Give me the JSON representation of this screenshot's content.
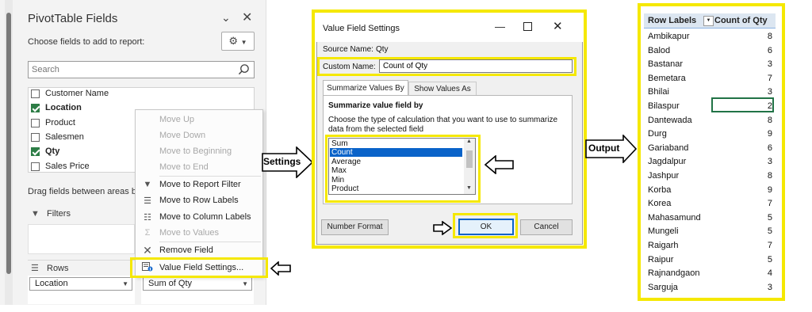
{
  "pivot_pane": {
    "title": "PivotTable Fields",
    "choose_label": "Choose fields to add to report:",
    "search_placeholder": "Search",
    "fields": [
      {
        "label": "Customer Name",
        "checked": false
      },
      {
        "label": "Location",
        "checked": true
      },
      {
        "label": "Product",
        "checked": false
      },
      {
        "label": "Salesmen",
        "checked": false
      },
      {
        "label": "Qty",
        "checked": true
      },
      {
        "label": "Sales Price",
        "checked": false
      }
    ],
    "drag_label": "Drag fields between areas be",
    "filters_label": "Filters",
    "rows_label": "Rows",
    "rows_chip": "Location",
    "values_chip": "Sum of Qty"
  },
  "context_menu": {
    "items": [
      {
        "label": "Move Up",
        "enabled": false,
        "icon": ""
      },
      {
        "label": "Move Down",
        "enabled": false,
        "icon": ""
      },
      {
        "label": "Move to Beginning",
        "enabled": false,
        "icon": ""
      },
      {
        "label": "Move to End",
        "enabled": false,
        "icon": ""
      },
      {
        "label": "Move to Report Filter",
        "enabled": true,
        "icon": "filter-icon"
      },
      {
        "label": "Move to Row Labels",
        "enabled": true,
        "icon": "rows-icon"
      },
      {
        "label": "Move to Column Labels",
        "enabled": true,
        "icon": "columns-icon"
      },
      {
        "label": "Move to Values",
        "enabled": false,
        "icon": "sigma-icon"
      },
      {
        "label": "Remove Field",
        "enabled": true,
        "icon": "x-icon"
      },
      {
        "label": "Value Field Settings...",
        "enabled": true,
        "icon": "field-settings-icon"
      }
    ]
  },
  "callouts": {
    "settings": "Settings",
    "output": "Output"
  },
  "dialog": {
    "title": "Value Field Settings",
    "source_name_label": "Source Name:",
    "source_name_value": "Qty",
    "custom_name_label": "Custom Name:",
    "custom_name_value": "Count of Qty",
    "tab_summarize": "Summarize Values By",
    "tab_show": "Show Values As",
    "summarize_header": "Summarize value field by",
    "summarize_desc": "Choose the type of calculation that you want to use to summarize data from the selected field",
    "functions": [
      "Sum",
      "Count",
      "Average",
      "Max",
      "Min",
      "Product"
    ],
    "selected_function": "Count",
    "number_format_label": "Number Format",
    "ok_label": "OK",
    "cancel_label": "Cancel"
  },
  "output": {
    "header_row_labels": "Row Labels",
    "header_count": "Count of Qty",
    "rows": [
      {
        "name": "Ambikapur",
        "count": "8"
      },
      {
        "name": "Balod",
        "count": "6"
      },
      {
        "name": "Bastanar",
        "count": "3"
      },
      {
        "name": "Bemetara",
        "count": "7"
      },
      {
        "name": "Bhilai",
        "count": "3"
      },
      {
        "name": "Bilaspur",
        "count": "2"
      },
      {
        "name": "Dantewada",
        "count": "8"
      },
      {
        "name": "Durg",
        "count": "9"
      },
      {
        "name": "Gariaband",
        "count": "6"
      },
      {
        "name": "Jagdalpur",
        "count": "3"
      },
      {
        "name": "Jashpur",
        "count": "8"
      },
      {
        "name": "Korba",
        "count": "9"
      },
      {
        "name": "Korea",
        "count": "7"
      },
      {
        "name": "Mahasamund",
        "count": "5"
      },
      {
        "name": "Mungeli",
        "count": "5"
      },
      {
        "name": "Raigarh",
        "count": "7"
      },
      {
        "name": "Raipur",
        "count": "5"
      },
      {
        "name": "Rajnandgaon",
        "count": "4"
      },
      {
        "name": "Sarguja",
        "count": "3"
      }
    ]
  },
  "colors": {
    "highlight": "#f5e800",
    "excel_green": "#217346",
    "selection_blue": "#0a63c9",
    "header_fill": "#dce6f1"
  }
}
